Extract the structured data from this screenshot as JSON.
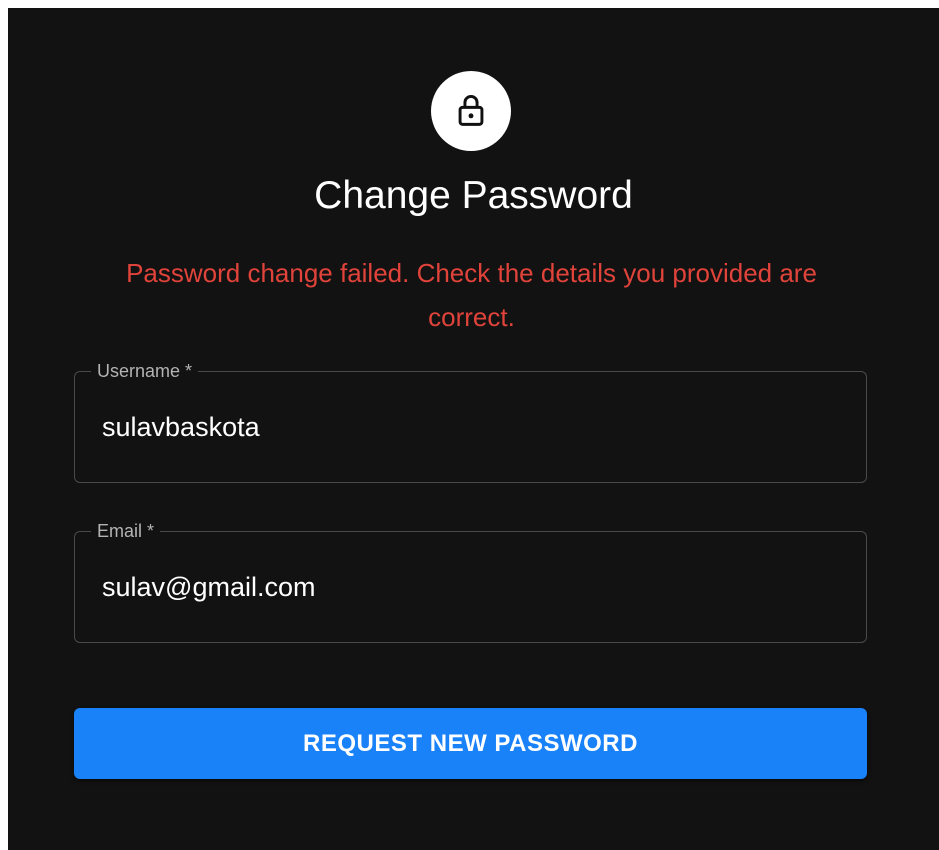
{
  "form": {
    "icon": "lock-icon",
    "title": "Change Password",
    "error_message": "Password change failed. Check the details you provided are correct.",
    "username": {
      "label": "Username *",
      "value": "sulavbaskota"
    },
    "email": {
      "label": "Email *",
      "value": "sulav@gmail.com"
    },
    "submit_label": "REQUEST NEW PASSWORD"
  },
  "colors": {
    "background": "#121212",
    "error": "#e0433a",
    "button": "#1a82f8",
    "text": "#ffffff"
  }
}
